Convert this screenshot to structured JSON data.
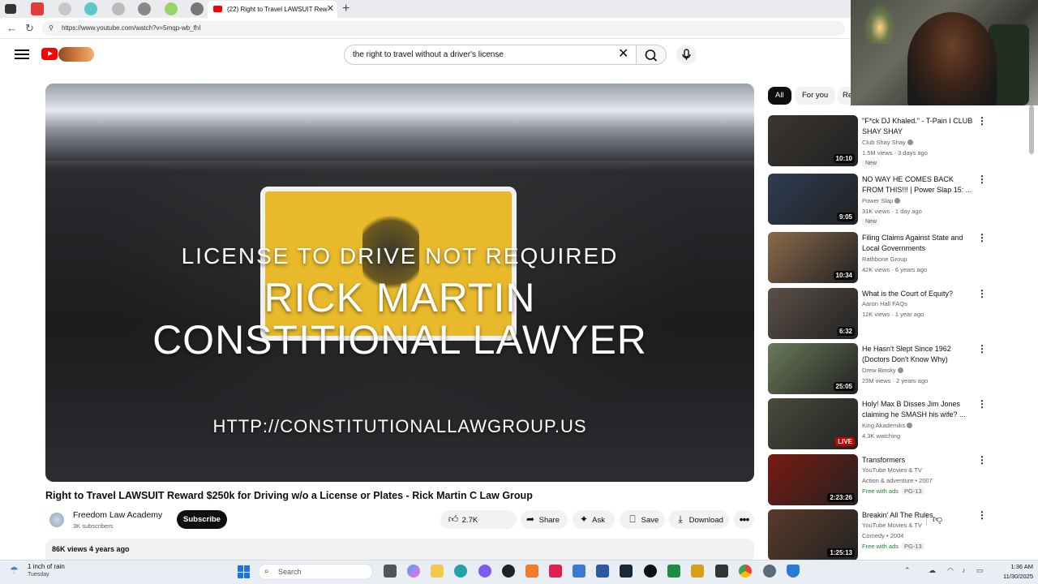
{
  "browser": {
    "active_tab_title": "(22) Right to Travel LAWSUIT Rew",
    "tab_close": "✕",
    "new_tab": "+",
    "url": "https://www.youtube.com/watch?v=5mqp-wb_fhI"
  },
  "header": {
    "search_query": "the right to travel without a driver's license",
    "clear_glyph": "✕"
  },
  "player": {
    "overlay_line1": "LICENSE TO DRIVE NOT REQUIRED",
    "overlay_line2": "RICK MARTIN",
    "overlay_line3": "CONSTITIONAL LAWYER",
    "overlay_line4": "HTTP://CONSTITUTIONALLAWGROUP.US"
  },
  "video": {
    "title": "Right to Travel LAWSUIT Reward $250k for Driving w/o a License or Plates - Rick Martin C Law Group",
    "channel_name": "Freedom Law Academy",
    "channel_subs": "3K subscribers",
    "subscribe_label": "Subscribe",
    "like_count": "2.7K",
    "share_label": "Share",
    "ask_label": "Ask",
    "save_label": "Save",
    "download_label": "Download",
    "more_glyph": "•••",
    "stats": "86K views  4 years ago"
  },
  "chips": {
    "all": "All",
    "for_you": "For you",
    "related": "Related"
  },
  "recommendations": [
    {
      "title": "\"F*ck DJ Khaled.\" - T-Pain I CLUB SHAY SHAY",
      "channel": "Club Shay Shay",
      "meta": "1.5M views · 3 days ago",
      "badge": "New",
      "duration": "10:10",
      "thumb_color": "#3a3530"
    },
    {
      "title": "NO WAY HE COMES BACK FROM THIS!!! | Power Slap 15: ...",
      "channel": "Power Slap",
      "meta": "31K views · 1 day ago",
      "badge": "New",
      "duration": "9:05",
      "thumb_color": "#2e3c52"
    },
    {
      "title": "Filing Claims Against State and Local Governments",
      "channel": "Rathbone Group",
      "meta": "42K views · 6 years ago",
      "duration": "10:34",
      "thumb_color": "#8a6a4a"
    },
    {
      "title": "What is the Court of Equity?",
      "channel": "Aaron Hall FAQs",
      "meta": "12K views · 1 year ago",
      "duration": "6:32",
      "thumb_color": "#5a5048"
    },
    {
      "title": "He Hasn't Slept Since 1962 (Doctors Don't Know Why)",
      "channel": "Drew Binsky",
      "meta": "23M views · 2 years ago",
      "duration": "25:05",
      "thumb_color": "#6a7a5a"
    },
    {
      "title": "Holy! Max B Disses Jim Jones claiming he SMASH his wife? ...",
      "channel": "King Akademiks",
      "meta": "4.3K watching",
      "duration": "LIVE",
      "thumb_color": "#4a4a3e"
    },
    {
      "title": "Transformers",
      "channel": "YouTube Movies & TV",
      "meta": "Action & adventure • 2007",
      "free": "Free with ads",
      "rating": "PG-13",
      "duration": "2:23:26",
      "thumb_color": "#7a1a10"
    },
    {
      "title": "Breakin' All The Rules",
      "channel": "YouTube Movies & TV",
      "meta": "Comedy • 2004",
      "free": "Free with ads",
      "rating": "PG-13",
      "duration": "1:25:13",
      "thumb_color": "#5a3a2a"
    }
  ],
  "taskbar": {
    "weather_title": "1 inch of rain",
    "weather_sub": "Tuesday",
    "search_label": "Search",
    "time": "1:36 AM",
    "date": "11/30/2025"
  },
  "colors": {
    "yt_red": "#ff0000",
    "accent": "#0f0f0f",
    "taskbar": "#e9eef5"
  }
}
